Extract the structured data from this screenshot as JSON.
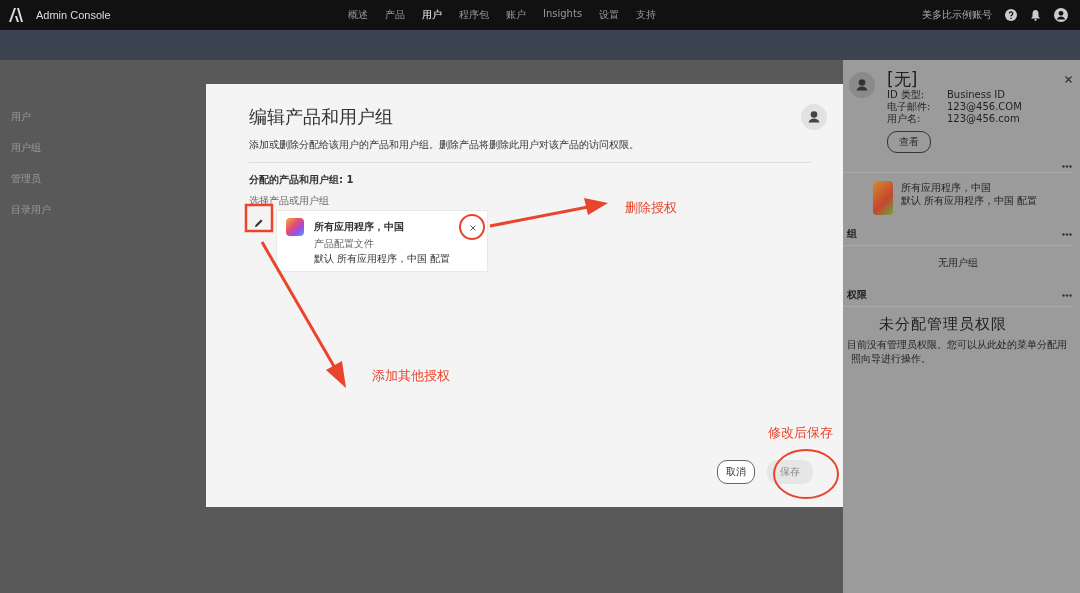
{
  "top_bar": {
    "brand": "Admin Console",
    "nav": [
      {
        "label": "概述",
        "selected": false
      },
      {
        "label": "产品",
        "selected": false
      },
      {
        "label": "用户",
        "selected": true
      },
      {
        "label": "程序包",
        "selected": false
      },
      {
        "label": "账户",
        "selected": false
      },
      {
        "label": "Insights",
        "selected": false
      },
      {
        "label": "设置",
        "selected": false
      },
      {
        "label": "支持",
        "selected": false
      }
    ],
    "account": "美多比示例账号"
  },
  "sidebar": {
    "items": [
      "用户",
      "用户组",
      "管理员",
      "目录用户"
    ]
  },
  "modal": {
    "title": "编辑产品和用户组",
    "description": "添加或删除分配给该用户的产品和用户组。删除产品将删除此用户对该产品的访问权限。",
    "assigned_label": "分配的产品和用户组: 1",
    "select_label": "选择产品或用户组",
    "product": {
      "name": "所有应用程序，中国",
      "type": "产品配置文件",
      "profile": "默认 所有应用程序，中国 配置"
    },
    "buttons": {
      "cancel": "取消",
      "save": {
        "label": "保存",
        "disabled": true
      }
    }
  },
  "user_panel": {
    "name": "[无]",
    "fields": [
      {
        "label": "ID 类型:",
        "value": "Business ID"
      },
      {
        "label": "电子邮件:",
        "value": "123@456.COM"
      },
      {
        "label": "用户名:",
        "value": "123@456.com"
      }
    ],
    "view_button": "查看",
    "product": {
      "name": "所有应用程序，中国",
      "profile": "默认 所有应用程序，中国 配置"
    },
    "groups_header": "组",
    "groups_empty": "无用户组",
    "admin_header": "权限",
    "admin_title": "未分配管理员权限",
    "admin_text": [
      "目前没有管理员权限。您可以从此处的菜单分配用",
      "照向导进行操作。"
    ]
  },
  "annotations": [
    "删除授权",
    "添加其他授权",
    "修改后保存"
  ]
}
